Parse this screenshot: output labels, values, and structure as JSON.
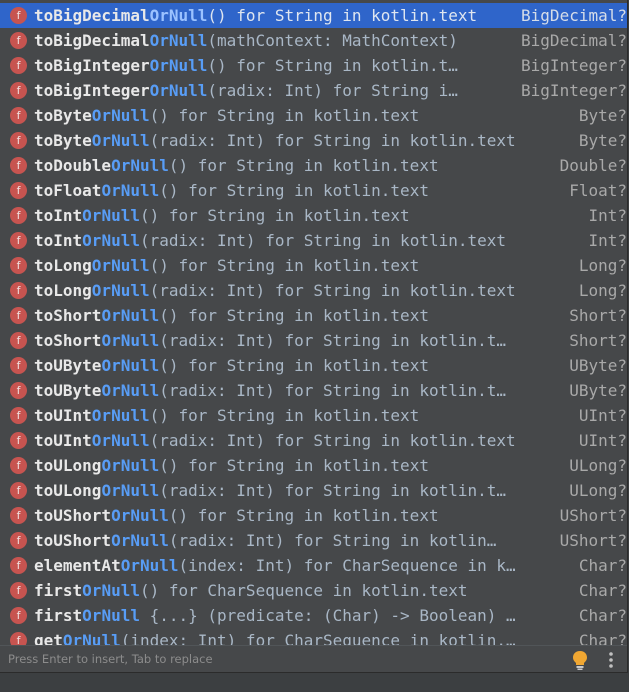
{
  "completion": {
    "items": [
      {
        "pre": "toBigDecimal",
        "hl": "OrNull",
        "post": "",
        "tail": "() for String in kotlin.text",
        "type": "BigDecimal?",
        "selected": true
      },
      {
        "pre": "toBigDecimal",
        "hl": "OrNull",
        "post": "",
        "tail": "(mathContext: MathContext)",
        "type": "BigDecimal?"
      },
      {
        "pre": "toBigInteger",
        "hl": "OrNull",
        "post": "",
        "tail": "() for String in kotlin.t…",
        "type": "BigInteger?"
      },
      {
        "pre": "toBigInteger",
        "hl": "OrNull",
        "post": "",
        "tail": "(radix: Int) for String i…",
        "type": "BigInteger?"
      },
      {
        "pre": "toByte",
        "hl": "OrNull",
        "post": "",
        "tail": "() for String in kotlin.text",
        "type": "Byte?"
      },
      {
        "pre": "toByte",
        "hl": "OrNull",
        "post": "",
        "tail": "(radix: Int) for String in kotlin.text",
        "type": "Byte?"
      },
      {
        "pre": "toDouble",
        "hl": "OrNull",
        "post": "",
        "tail": "() for String in kotlin.text",
        "type": "Double?"
      },
      {
        "pre": "toFloat",
        "hl": "OrNull",
        "post": "",
        "tail": "() for String in kotlin.text",
        "type": "Float?"
      },
      {
        "pre": "toInt",
        "hl": "OrNull",
        "post": "",
        "tail": "() for String in kotlin.text",
        "type": "Int?"
      },
      {
        "pre": "toInt",
        "hl": "OrNull",
        "post": "",
        "tail": "(radix: Int) for String in kotlin.text",
        "type": "Int?"
      },
      {
        "pre": "toLong",
        "hl": "OrNull",
        "post": "",
        "tail": "() for String in kotlin.text",
        "type": "Long?"
      },
      {
        "pre": "toLong",
        "hl": "OrNull",
        "post": "",
        "tail": "(radix: Int) for String in kotlin.text",
        "type": "Long?"
      },
      {
        "pre": "toShort",
        "hl": "OrNull",
        "post": "",
        "tail": "() for String in kotlin.text",
        "type": "Short?"
      },
      {
        "pre": "toShort",
        "hl": "OrNull",
        "post": "",
        "tail": "(radix: Int) for String in kotlin.t…",
        "type": "Short?"
      },
      {
        "pre": "toUByte",
        "hl": "OrNull",
        "post": "",
        "tail": "() for String in kotlin.text",
        "type": "UByte?"
      },
      {
        "pre": "toUByte",
        "hl": "OrNull",
        "post": "",
        "tail": "(radix: Int) for String in kotlin.t…",
        "type": "UByte?"
      },
      {
        "pre": "toUInt",
        "hl": "OrNull",
        "post": "",
        "tail": "() for String in kotlin.text",
        "type": "UInt?"
      },
      {
        "pre": "toUInt",
        "hl": "OrNull",
        "post": "",
        "tail": "(radix: Int) for String in kotlin.text",
        "type": "UInt?"
      },
      {
        "pre": "toULong",
        "hl": "OrNull",
        "post": "",
        "tail": "() for String in kotlin.text",
        "type": "ULong?"
      },
      {
        "pre": "toULong",
        "hl": "OrNull",
        "post": "",
        "tail": "(radix: Int) for String in kotlin.t…",
        "type": "ULong?"
      },
      {
        "pre": "toUShort",
        "hl": "OrNull",
        "post": "",
        "tail": "() for String in kotlin.text",
        "type": "UShort?"
      },
      {
        "pre": "toUShort",
        "hl": "OrNull",
        "post": "",
        "tail": "(radix: Int) for String in kotlin…",
        "type": "UShort?"
      },
      {
        "pre": "elementAt",
        "hl": "OrNull",
        "post": "",
        "tail": "(index: Int) for CharSequence in k…",
        "type": "Char?"
      },
      {
        "pre": "first",
        "hl": "OrNull",
        "post": "",
        "tail": "() for CharSequence in kotlin.text",
        "type": "Char?"
      },
      {
        "pre": "first",
        "hl": "OrNull",
        "post": "",
        "tail": " {...} (predicate: (Char) -> Boolean) …",
        "type": "Char?"
      },
      {
        "pre": "get",
        "hl": "OrNull",
        "post": "",
        "tail": "(index: Int) for CharSequence in kotlin.…",
        "type": "Char?"
      }
    ],
    "icon_letter": "f",
    "status_hint": "Press Enter to insert, Tab to replace",
    "icons": {
      "suggest": "bulb-icon",
      "menu": "more-vertical-icon"
    },
    "colors": {
      "selection": "#2f65ca",
      "match": "#589df6",
      "function_icon": "#c75450"
    }
  }
}
